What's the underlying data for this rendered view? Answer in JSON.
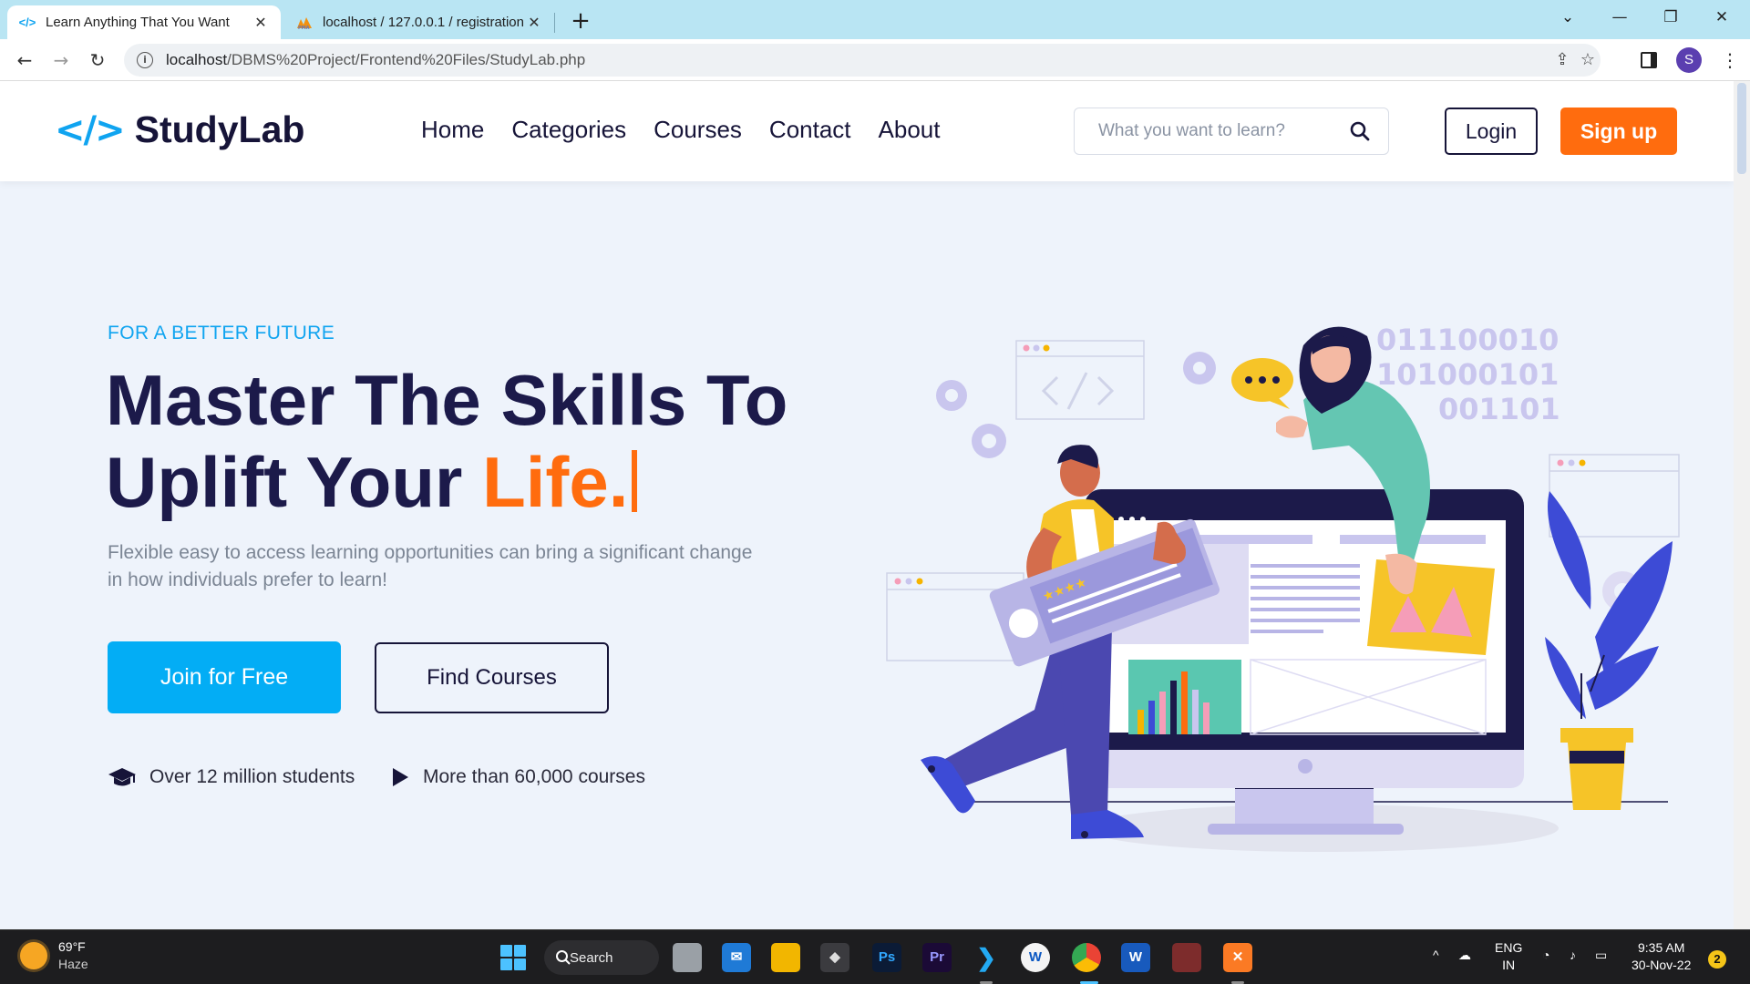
{
  "browser": {
    "tabs": [
      {
        "title": "Learn Anything That You Want",
        "icon": "code-icon",
        "active": true
      },
      {
        "title": "localhost / 127.0.0.1 / registration",
        "icon": "phpmyadmin-icon",
        "active": false
      }
    ],
    "url_host": "localhost",
    "url_path": "/DBMS%20Project/Frontend%20Files/StudyLab.php",
    "profile_initial": "S"
  },
  "site": {
    "logo_icon": "</>",
    "logo_text": "StudyLab",
    "nav": [
      "Home",
      "Categories",
      "Courses",
      "Contact",
      "About"
    ],
    "search_placeholder": "What you want to learn?",
    "login_label": "Login",
    "signup_label": "Sign up",
    "colors": {
      "primary": "#10a4f0",
      "accent": "#ff6c0e",
      "dark": "#1c1a4a"
    }
  },
  "hero": {
    "eyebrow": "FOR A BETTER FUTURE",
    "headline_line1": "Master The Skills To",
    "headline_line2": "Uplift Your ",
    "headline_accent": "Life.",
    "subtext": "Flexible easy to access learning opportunities can bring a significant change in how individuals prefer to learn!",
    "join_label": "Join for Free",
    "find_label": "Find Courses",
    "stats": [
      {
        "icon": "graduation-cap-icon",
        "text": "Over 12 million students"
      },
      {
        "icon": "play-icon",
        "text": "More than 60,000 courses"
      }
    ],
    "illustration_binary": [
      "011100010",
      "101000101",
      "001101"
    ]
  },
  "taskbar": {
    "weather_temp": "69°F",
    "weather_desc": "Haze",
    "search_label": "Search",
    "apps": [
      {
        "name": "task-view",
        "label": ""
      },
      {
        "name": "mail",
        "label": ""
      },
      {
        "name": "file-explorer",
        "label": ""
      },
      {
        "name": "unity",
        "label": ""
      },
      {
        "name": "photoshop",
        "label": "Ps"
      },
      {
        "name": "premiere",
        "label": "Pr"
      },
      {
        "name": "vscode",
        "label": ""
      },
      {
        "name": "app-w",
        "label": ""
      },
      {
        "name": "chrome",
        "label": ""
      },
      {
        "name": "word",
        "label": "W"
      },
      {
        "name": "game",
        "label": ""
      },
      {
        "name": "xampp",
        "label": ""
      }
    ],
    "lang_line1": "ENG",
    "lang_line2": "IN",
    "time": "9:35 AM",
    "date": "30-Nov-22",
    "notification_count": "2"
  }
}
